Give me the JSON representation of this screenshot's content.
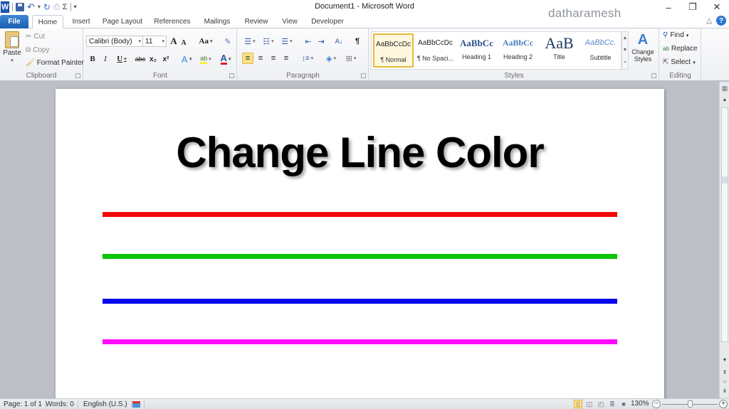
{
  "window": {
    "title": "Document1 - Microsoft Word",
    "watermark": "datharamesh",
    "minimize_glyph": "–",
    "restore_glyph": "❐",
    "close_glyph": "✕"
  },
  "quick_access": {
    "app_icon": "W",
    "save_icon": "save-icon",
    "undo_glyph": "↶",
    "undo_dropdown": "▾",
    "redo_glyph": "↻",
    "sum_glyph": "Σ",
    "customize_glyph": "▾"
  },
  "tabs": [
    {
      "label": "File"
    },
    {
      "label": "Home"
    },
    {
      "label": "Insert"
    },
    {
      "label": "Page Layout"
    },
    {
      "label": "References"
    },
    {
      "label": "Mailings"
    },
    {
      "label": "Review"
    },
    {
      "label": "View"
    },
    {
      "label": "Developer"
    }
  ],
  "active_tab": "Home",
  "help_glyph": "?",
  "minimize_ribbon_glyph": "△",
  "ribbon": {
    "clipboard": {
      "label": "Clipboard",
      "paste": "Paste",
      "cut": "Cut",
      "copy": "Copy",
      "format_painter": "Format Painter"
    },
    "font": {
      "label": "Font",
      "font_name": "Calibri (Body)",
      "font_size": "11",
      "grow": "A",
      "shrink": "A",
      "change_case": "Aa",
      "clear_format": "✎",
      "bold": "B",
      "italic": "I",
      "underline": "U",
      "strikethrough": "abc",
      "subscript": "x₂",
      "superscript": "x²",
      "text_effects": "A",
      "highlight": "ab",
      "font_color": "A",
      "font_color_value": "#e02020"
    },
    "paragraph": {
      "label": "Paragraph",
      "bullets": "☰",
      "numbering": "☷",
      "multilevel": "☰",
      "decrease_indent": "⇤",
      "increase_indent": "⇥",
      "sort": "A↓",
      "show_marks": "¶",
      "align_left": "≡",
      "center": "≡",
      "align_right": "≡",
      "justify": "≡",
      "line_spacing": "↕≡",
      "shading": "◈",
      "borders": "⊞"
    },
    "styles": {
      "label": "Styles",
      "items": [
        {
          "preview": "AaBbCcDc",
          "name": "¶ Normal",
          "selected": true
        },
        {
          "preview": "AaBbCcDc",
          "name": "¶ No Spaci...",
          "selected": false
        },
        {
          "preview": "AaBbCc",
          "name": "Heading 1",
          "selected": false
        },
        {
          "preview": "AaBbCc",
          "name": "Heading 2",
          "selected": false
        },
        {
          "preview": "AaB",
          "name": "Title",
          "selected": false
        },
        {
          "preview": "AaBbCc.",
          "name": "Subtitle",
          "selected": false
        }
      ],
      "change_styles": "Change Styles"
    },
    "editing": {
      "label": "Editing",
      "find": "Find",
      "replace": "Replace",
      "select": "Select"
    }
  },
  "document": {
    "heading": "Change Line Color",
    "lines": [
      {
        "color": "#f20a0a"
      },
      {
        "color": "#08c408"
      },
      {
        "color": "#0808f0"
      },
      {
        "color": "#ff08ff"
      }
    ]
  },
  "status": {
    "page": "Page: 1 of 1",
    "words": "Words: 0",
    "language": "English (U.S.)",
    "zoom": "130%",
    "zoom_minus": "−",
    "zoom_plus": "+",
    "zoom_level_fraction": 0.5
  }
}
